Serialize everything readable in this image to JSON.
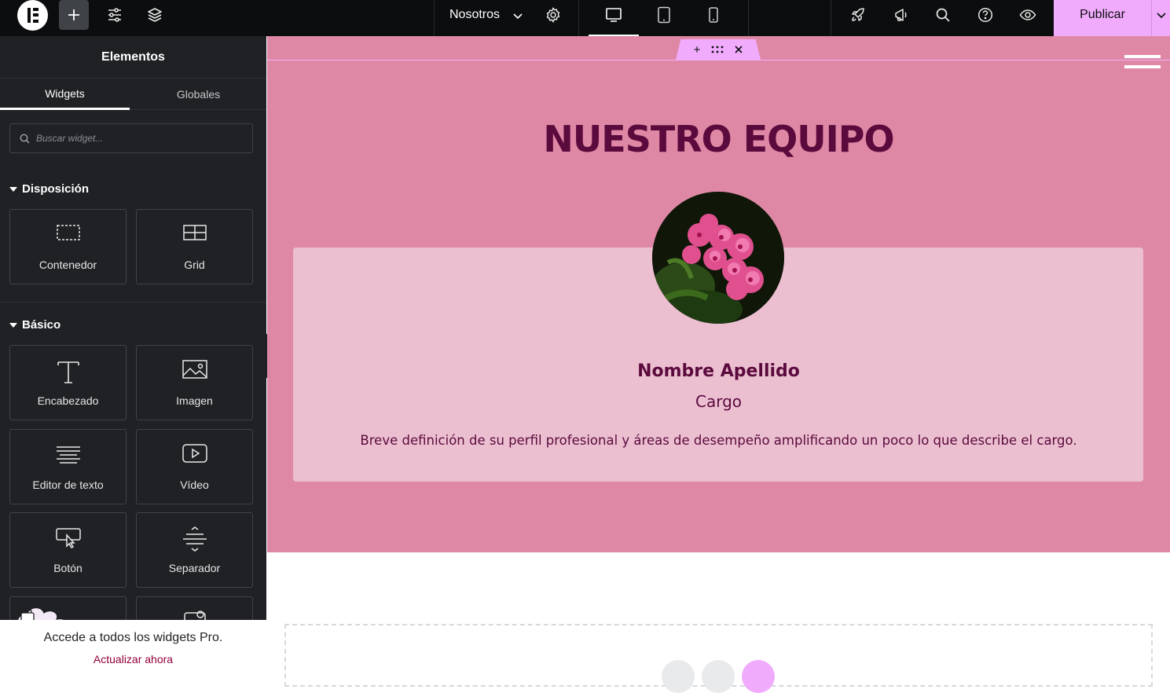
{
  "topbar": {
    "page_title": "Nosotros",
    "publish_label": "Publicar",
    "icons": [
      "elementor-logo-icon",
      "add-icon",
      "site-settings-icon",
      "structure-layers-icon",
      "page-settings-icon",
      "desktop-icon",
      "tablet-icon",
      "mobile-icon",
      "launchpad-rocket-icon",
      "whats-new-megaphone-icon",
      "finder-search-icon",
      "help-icon",
      "preview-eye-icon"
    ],
    "accent_color": "#f0abfc"
  },
  "panel": {
    "title": "Elementos",
    "tabs": [
      {
        "label": "Widgets",
        "active": true
      },
      {
        "label": "Globales",
        "active": false
      }
    ],
    "search_placeholder": "Buscar widget...",
    "sections": [
      {
        "title": "Disposición",
        "widgets": [
          {
            "label": "Contenedor",
            "icon": "container-icon"
          },
          {
            "label": "Grid",
            "icon": "grid-icon"
          }
        ]
      },
      {
        "title": "Básico",
        "widgets": [
          {
            "label": "Encabezado",
            "icon": "heading-icon"
          },
          {
            "label": "Imagen",
            "icon": "image-icon"
          },
          {
            "label": "Editor de texto",
            "icon": "text-editor-icon"
          },
          {
            "label": "Vídeo",
            "icon": "video-icon"
          },
          {
            "label": "Botón",
            "icon": "button-icon"
          },
          {
            "label": "Separador",
            "icon": "divider-icon"
          }
        ]
      }
    ],
    "promo": {
      "text": "Accede a todos los widgets Pro.",
      "link": "Actualizar ahora"
    }
  },
  "canvas": {
    "section_bg": "#df88a5",
    "card_bg": "#ebbfd0",
    "text_color": "#5b0a3d",
    "heading": "NUESTRO EQUIPO",
    "member": {
      "name": "Nombre Apellido",
      "role": "Cargo",
      "bio": "Breve definición de su perfil profesional y áreas de desempeño amplificando un poco lo que describe el cargo."
    }
  }
}
